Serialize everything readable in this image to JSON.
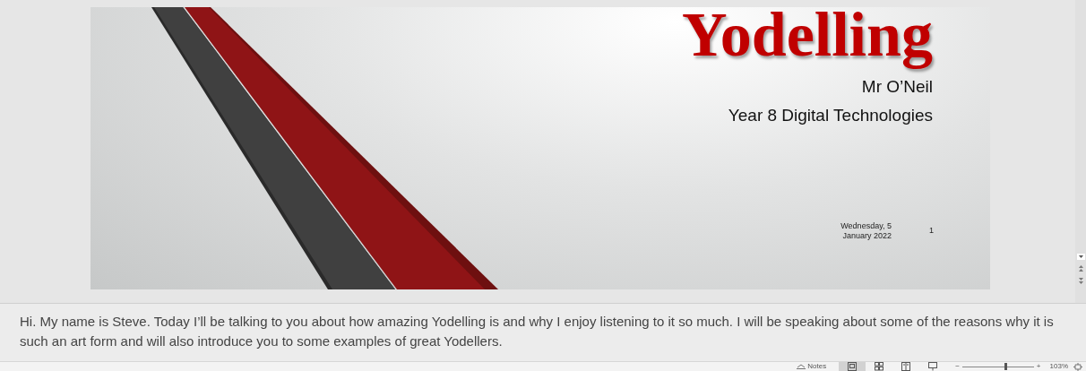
{
  "slide": {
    "title": "Yodelling",
    "subtitle_lines": [
      "Mr O’Neil",
      "Year 8 Digital Technologies"
    ],
    "date": "Wednesday, 5 January 2022",
    "slide_number": "1"
  },
  "notes": {
    "value": "Hi. My name is Steve. Today I’ll be talking to you about how amazing Yodelling is and why I enjoy listening to it so much. I will be speaking about some of the reasons why it is such an art form and will also introduce you to some examples of great Yodellers."
  },
  "status_bar": {
    "notes_button": "Notes",
    "views": [
      {
        "kind": "normal",
        "selected": true
      },
      {
        "kind": "sorter",
        "selected": false
      },
      {
        "kind": "reading",
        "selected": false
      },
      {
        "kind": "slideshow",
        "selected": false
      }
    ],
    "zoom_minus": "−",
    "zoom_plus": "+",
    "zoom": {
      "level": 0.6
    },
    "zoom_reading": "103%"
  }
}
